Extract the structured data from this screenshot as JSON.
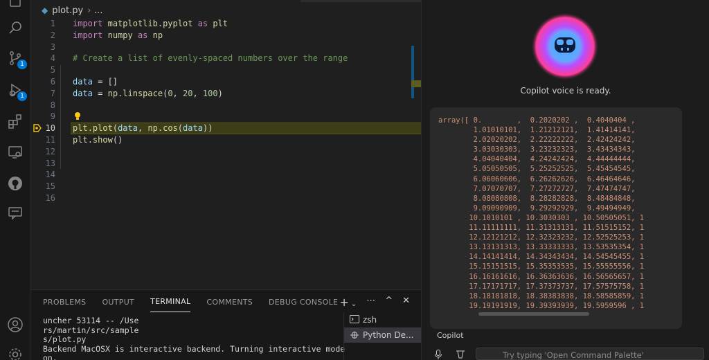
{
  "editor": {
    "tab_filename": "plot.py",
    "breadcrumb_more": "…",
    "lines": [
      {
        "n": "1"
      },
      {
        "n": "2"
      },
      {
        "n": "3"
      },
      {
        "n": "4"
      },
      {
        "n": "5"
      },
      {
        "n": "6"
      },
      {
        "n": "7"
      },
      {
        "n": "8"
      },
      {
        "n": "9"
      },
      {
        "n": "10"
      },
      {
        "n": "11"
      },
      {
        "n": "12"
      },
      {
        "n": "13"
      },
      {
        "n": "14"
      },
      {
        "n": "15"
      },
      {
        "n": "16"
      }
    ],
    "code": {
      "l1": {
        "kw1": "import",
        "mod": "matplotlib.pyplot",
        "kw2": "as",
        "alias": "plt"
      },
      "l2": {
        "kw1": "import",
        "mod": "numpy",
        "kw2": "as",
        "alias": "np"
      },
      "l4": "# Create a list of evenly-spaced numbers over the range",
      "l6": {
        "var": "data",
        "rest": " = []"
      },
      "l7": {
        "var": "data",
        "eq": " = ",
        "obj": "np",
        "fn": "linspace",
        "open": "(",
        "a": "0",
        "b": "20",
        "c": "100",
        "close": ")"
      },
      "l10": {
        "obj": "plt",
        "fn": "plot",
        "arg1": "data",
        "obj2": "np",
        "fn2": "cos",
        "arg2": "data"
      },
      "l11": {
        "obj": "plt",
        "fn": "show",
        "rest": "()"
      }
    }
  },
  "panel": {
    "tabs": [
      "PROBLEMS",
      "OUTPUT",
      "TERMINAL",
      "COMMENTS",
      "DEBUG CONSOLE"
    ],
    "actions": {
      "add": "+",
      "dropdown": "⌄",
      "more": "⋯",
      "maximize": "^",
      "close": "✕"
    },
    "terminal_lines": [
      "uncher 53114 -- /Use",
      "rs/martin/src/sample",
      "s/plot.py",
      "Backend MacOSX is interactive backend. Turning interactive mode",
      "on."
    ],
    "terminals": [
      "zsh",
      "Python De..."
    ]
  },
  "copilot": {
    "voice_status": "Copilot voice is ready.",
    "output_text": "array([ 0.        ,  0.2020202 ,  0.4040404 ,\n        1.01010101,  1.21212121,  1.41414141,\n        2.02020202,  2.22222222,  2.42424242,\n        3.03030303,  3.23232323,  3.43434343,\n        4.04040404,  4.24242424,  4.44444444,\n        5.05050505,  5.25252525,  5.45454545,\n        6.06060606,  6.26262626,  6.46464646,\n        7.07070707,  7.27272727,  7.47474747,\n        8.08080808,  8.28282828,  8.48484848,\n        9.09090909,  9.29292929,  9.49494949,\n       10.1010101 , 10.3030303 , 10.50505051, 1\n       11.11111111, 11.31313131, 11.51515152, 1\n       12.12121212, 12.32323232, 12.52525253, 1\n       13.13131313, 13.33333333, 13.53535354, 1\n       14.14141414, 14.34343434, 14.54545455, 1\n       15.15151515, 15.35353535, 15.55555556, 1\n       16.16161616, 16.36363636, 16.56565657, 1\n       17.17171717, 17.37373737, 17.57575758, 1\n       18.18181818, 18.38383838, 18.58585859, 1\n       19.19191919, 19.39393939, 19.5959596 , 1",
    "label": "Copilot",
    "input_placeholder": "Try typing 'Open Command Palette'"
  },
  "activity": {
    "scm_badge": "1",
    "debug_badge": "1"
  }
}
